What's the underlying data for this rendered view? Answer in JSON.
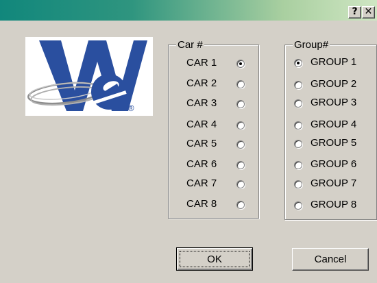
{
  "title_bar": {
    "help_glyph": "?",
    "close_glyph": "✕"
  },
  "logo": {
    "icon": "we-logo-icon",
    "registered_mark": "®"
  },
  "car_group": {
    "legend": "Car #",
    "items": [
      {
        "label": "CAR 1",
        "checked": true
      },
      {
        "label": "CAR 2",
        "checked": false
      },
      {
        "label": "CAR 3",
        "checked": false
      },
      {
        "label": "CAR 4",
        "checked": false
      },
      {
        "label": "CAR 5",
        "checked": false
      },
      {
        "label": "CAR 6",
        "checked": false
      },
      {
        "label": "CAR 7",
        "checked": false
      },
      {
        "label": "CAR 8",
        "checked": false
      }
    ]
  },
  "group_group": {
    "legend": "Group#",
    "items": [
      {
        "label": "GROUP 1",
        "checked": true
      },
      {
        "label": "GROUP 2",
        "checked": false
      },
      {
        "label": "GROUP 3",
        "checked": false
      },
      {
        "label": "GROUP 4",
        "checked": false
      },
      {
        "label": "GROUP 5",
        "checked": false
      },
      {
        "label": "GROUP 6",
        "checked": false
      },
      {
        "label": "GROUP 7",
        "checked": false
      },
      {
        "label": "GROUP 8",
        "checked": false
      }
    ]
  },
  "buttons": {
    "ok_label": "OK",
    "cancel_label": "Cancel"
  },
  "colors": {
    "dialog_face": "#d4d0c8",
    "title_gradient_start": "#11877c",
    "title_gradient_end": "#cfe6c3",
    "logo_blue": "#2a4f9f"
  }
}
